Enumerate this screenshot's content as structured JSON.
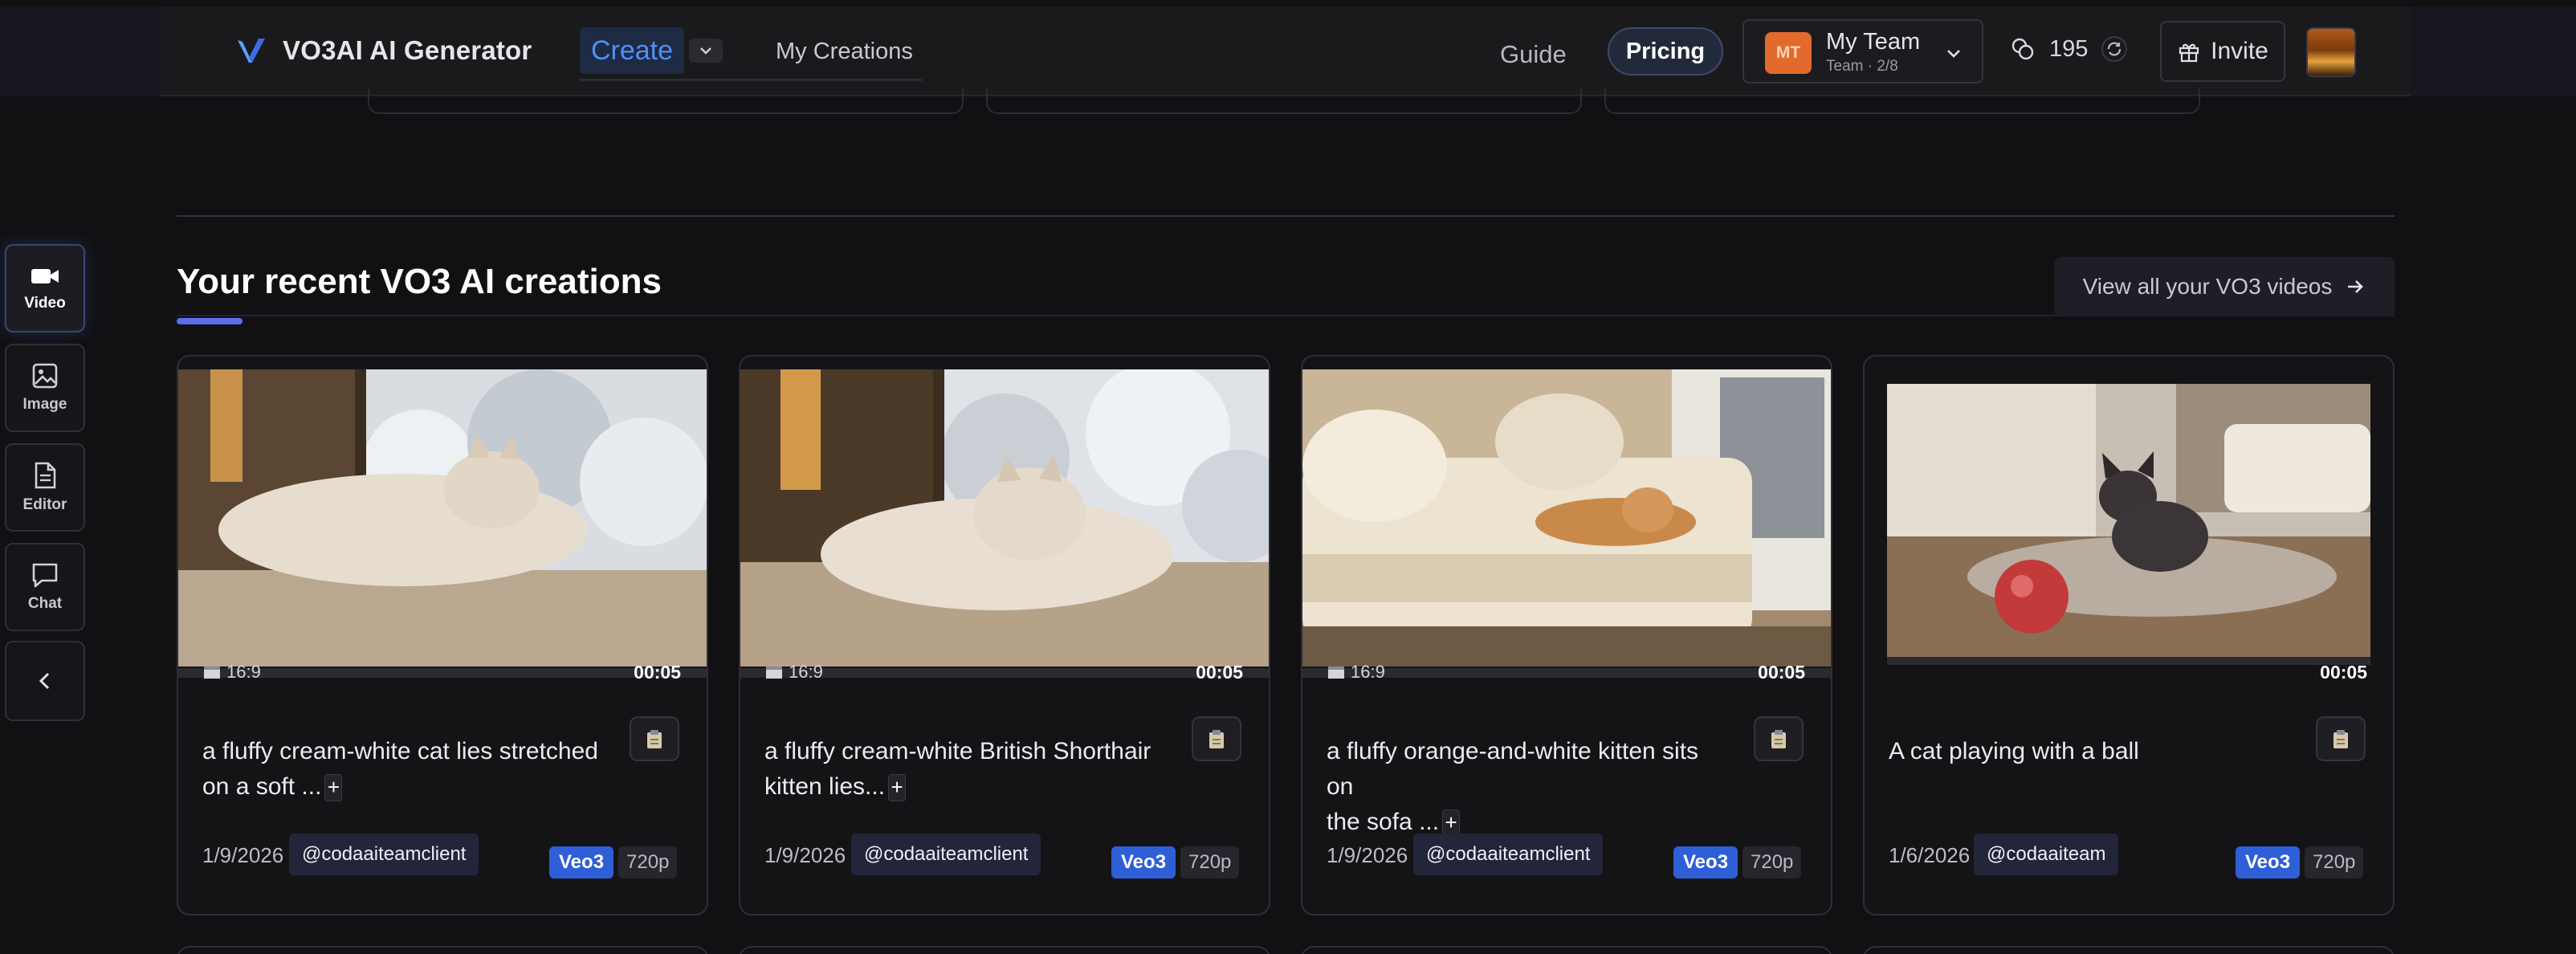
{
  "header": {
    "brand": "VO3AI AI Generator",
    "nav": {
      "create": "Create",
      "my_creations": "My Creations"
    },
    "guide": "Guide",
    "pricing": "Pricing",
    "team": {
      "avatar_initials": "MT",
      "name": "My Team",
      "sub": "Team · 2/8"
    },
    "credits": "195",
    "invite": "Invite"
  },
  "sidebar": {
    "items": [
      {
        "label": "Video",
        "icon": "video-icon",
        "active": true
      },
      {
        "label": "Image",
        "icon": "image-icon",
        "active": false
      },
      {
        "label": "Editor",
        "icon": "document-icon",
        "active": false
      },
      {
        "label": "Chat",
        "icon": "chat-icon",
        "active": false
      }
    ]
  },
  "section": {
    "title": "Your recent VO3 AI creations",
    "view_all": "View all your VO3 videos"
  },
  "cards": [
    {
      "aspect": "16:9",
      "duration": "00:05",
      "desc_line1": "a fluffy cream-white cat lies stretched",
      "desc_line2": "on a soft ...",
      "date": "1/9/2026",
      "user": "@codaaiteamclient",
      "model": "Veo3",
      "resolution": "720p",
      "thumb": "cream cat by snowy window"
    },
    {
      "aspect": "16:9",
      "duration": "00:05",
      "desc_line1": "a fluffy cream-white British Shorthair",
      "desc_line2": "kitten lies...",
      "date": "1/9/2026",
      "user": "@codaaiteamclient",
      "model": "Veo3",
      "resolution": "720p",
      "thumb": "british shorthair kitten by window"
    },
    {
      "aspect": "16:9",
      "duration": "00:05",
      "desc_line1": "a fluffy orange-and-white kitten sits on",
      "desc_line2": "the sofa ...",
      "date": "1/9/2026",
      "user": "@codaaiteamclient",
      "model": "Veo3",
      "resolution": "720p",
      "thumb": "orange kitten on sofa"
    },
    {
      "aspect": "",
      "duration": "00:05",
      "desc_line1": "A cat playing with a ball",
      "desc_line2": "",
      "date": "1/6/2026",
      "user": "@codaaiteam",
      "model": "Veo3",
      "resolution": "720p",
      "thumb": "sphynx cat with red ball"
    }
  ],
  "colors": {
    "accent": "#4f8ff7",
    "model_badge": "#2f5fd6",
    "title_accent": "#5c6ef0"
  }
}
